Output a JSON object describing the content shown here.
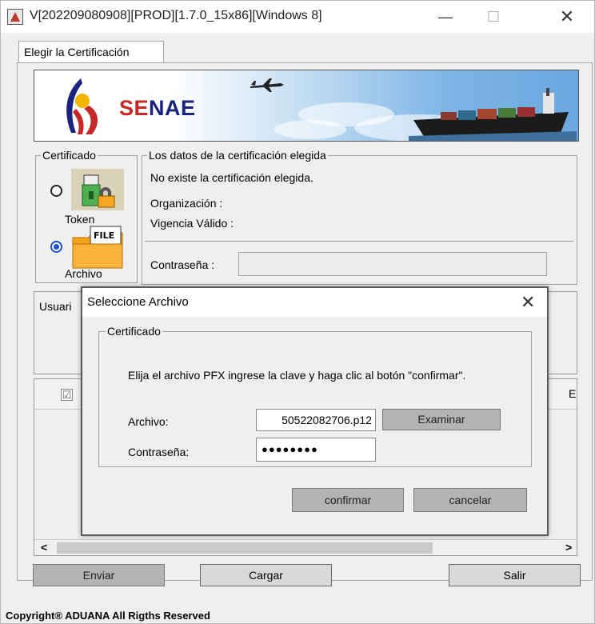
{
  "window": {
    "title": "V[202209080908][PROD][1.7.0_15x86][Windows 8]",
    "minimize": "—",
    "maximize": "☐",
    "close": "✕"
  },
  "tab": {
    "label": "Elegir la Certificación"
  },
  "banner": {
    "brand_part1": "SE",
    "brand_part2": "NAE"
  },
  "certificado": {
    "legend": "Certificado",
    "token_label": "Token",
    "archivo_label": "Archivo",
    "file_icon_text": "FILE",
    "selected": "Archivo"
  },
  "datos": {
    "legend": "Los datos de la certificación elegida",
    "status": "No existe la certificación elegida.",
    "organizacion_label": "Organización :",
    "vigencia_label": "Vigencia Válido :",
    "password_label": "Contraseña :"
  },
  "user_panel": {
    "header_partial": "Usuari"
  },
  "table": {
    "check_mark": "☑",
    "right_partial": "E",
    "scroll_left": "<",
    "scroll_right": ">"
  },
  "buttons": {
    "enviar": "Enviar",
    "cargar": "Cargar",
    "salir": "Salir"
  },
  "footer": "Copyright® ADUANA All Rigths Reserved",
  "dialog": {
    "title": "Seleccione Archivo",
    "close": "✕",
    "legend": "Certificado",
    "instructions": "Elija el archivo PFX ingrese la clave y haga clic al botón \"confirmar\".",
    "archivo_label": "Archivo:",
    "archivo_value": "50522082706.p12",
    "examinar": "Examinar",
    "password_label": "Contraseña:",
    "password_value": "●●●●●●●●",
    "confirmar": "confirmar",
    "cancelar": "cancelar"
  },
  "colors": {
    "window_bg": "#efefef",
    "brand_red": "#c62828",
    "brand_blue": "#1a237e",
    "radio_selected": "#1a4fd6"
  }
}
